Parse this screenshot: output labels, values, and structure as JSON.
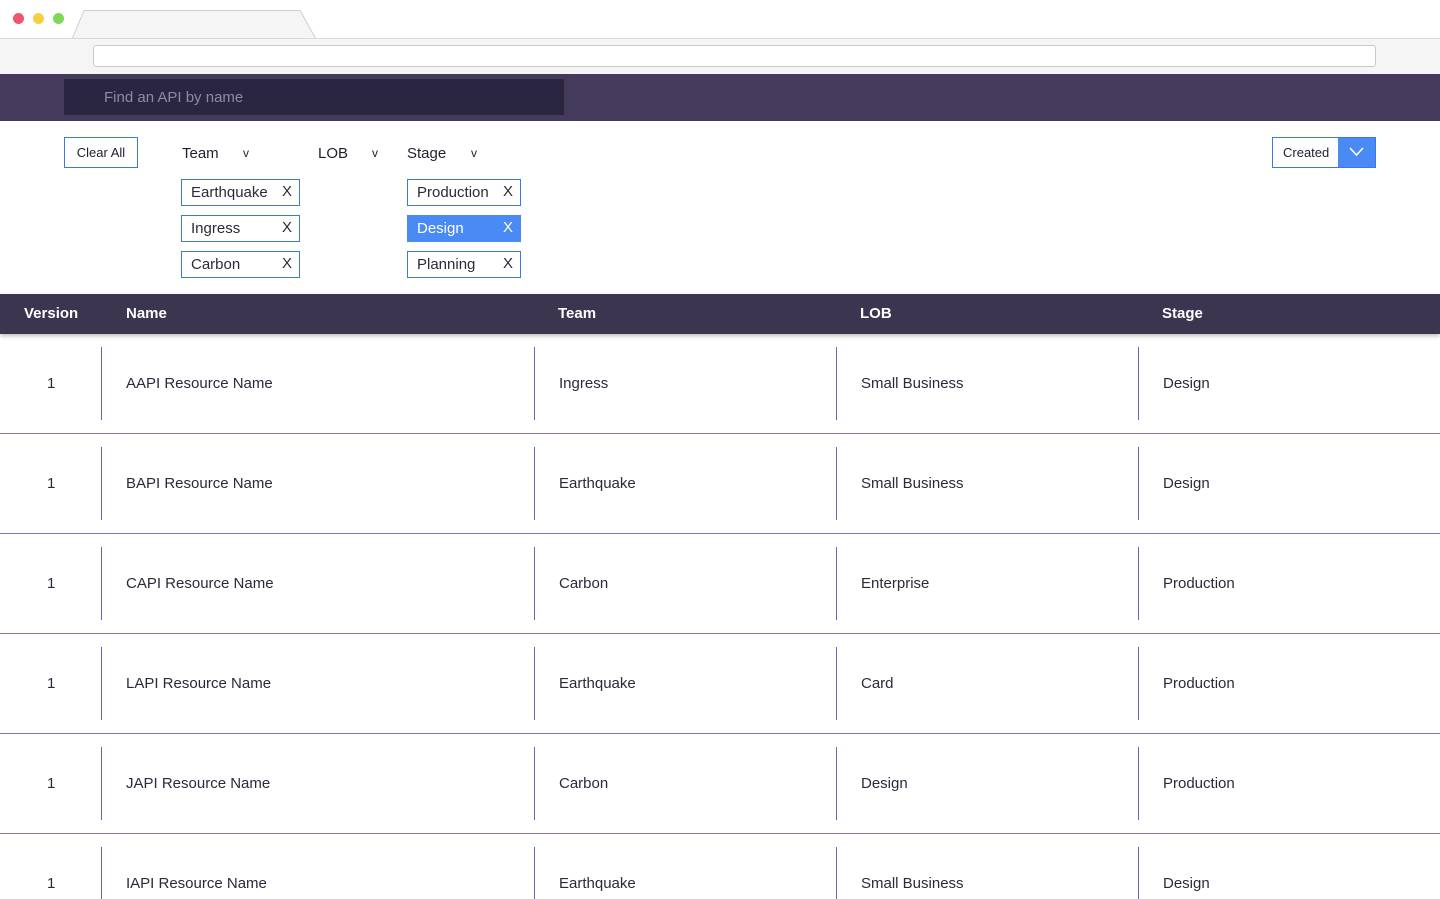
{
  "search": {
    "placeholder": "Find an API by name"
  },
  "filters": {
    "clear_all_label": "Clear All",
    "team": {
      "label": "Team",
      "chevron": "v",
      "chips": [
        {
          "label": "Earthquake",
          "remove": "X",
          "active": false
        },
        {
          "label": "Ingress",
          "remove": "X",
          "active": false
        },
        {
          "label": "Carbon",
          "remove": "X",
          "active": false
        }
      ]
    },
    "lob": {
      "label": "LOB",
      "chevron": "v"
    },
    "stage": {
      "label": "Stage",
      "chevron": "v",
      "chips": [
        {
          "label": "Production",
          "remove": "X",
          "active": false
        },
        {
          "label": "Design",
          "remove": "X",
          "active": true
        },
        {
          "label": "Planning",
          "remove": "X",
          "active": false
        }
      ]
    }
  },
  "sort": {
    "label": "Created",
    "icon": "chevron-down-icon"
  },
  "table": {
    "columns": [
      "Version",
      "Name",
      "Team",
      "LOB",
      "Stage"
    ],
    "rows": [
      {
        "version": "1",
        "name": "AAPI Resource Name",
        "team": "Ingress",
        "lob": "Small Business",
        "stage": "Design"
      },
      {
        "version": "1",
        "name": "BAPI Resource Name",
        "team": "Earthquake",
        "lob": "Small Business",
        "stage": "Design"
      },
      {
        "version": "1",
        "name": "CAPI Resource Name",
        "team": "Carbon",
        "lob": "Enterprise",
        "stage": "Production"
      },
      {
        "version": "1",
        "name": "LAPI Resource Name",
        "team": "Earthquake",
        "lob": "Card",
        "stage": "Production"
      },
      {
        "version": "1",
        "name": "JAPI Resource Name",
        "team": "Carbon",
        "lob": "Design",
        "stage": "Production"
      },
      {
        "version": "1",
        "name": "IAPI Resource Name",
        "team": "Earthquake",
        "lob": "Small Business",
        "stage": "Design"
      }
    ]
  },
  "colors": {
    "header_bg": "#433a5c",
    "table_head_bg": "#3b3550",
    "accent": "#4a8af4",
    "row_divider": "#7b74c9"
  }
}
